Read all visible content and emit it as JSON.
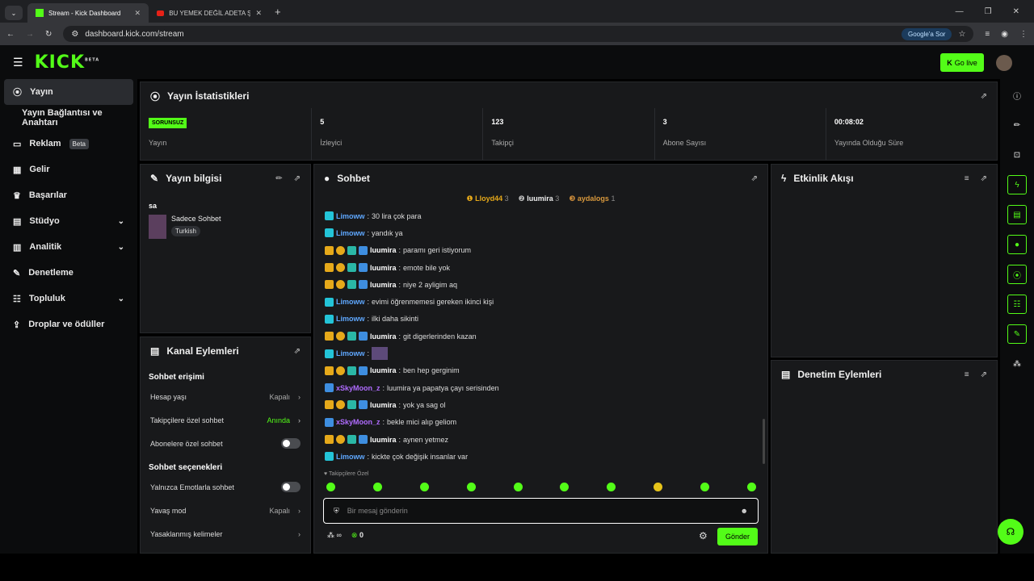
{
  "browser": {
    "tabs": [
      {
        "title": "Stream - Kick Dashboard"
      },
      {
        "title": "BU YEMEK DEĞİL ADETA ŞÖLEN"
      }
    ],
    "url": "dashboard.kick.com/stream",
    "google_button": "Google'a Sor"
  },
  "topbar": {
    "logo": "KICK",
    "logo_sup": "BETA",
    "golive": "Go live"
  },
  "sidebar": {
    "items": [
      {
        "label": "Yayın"
      },
      {
        "label": "Yayın Bağlantısı ve Anahtarı"
      },
      {
        "label": "Reklam",
        "badge": "Beta"
      },
      {
        "label": "Gelir"
      },
      {
        "label": "Başarılar"
      },
      {
        "label": "Stüdyo"
      },
      {
        "label": "Analitik"
      },
      {
        "label": "Denetleme"
      },
      {
        "label": "Topluluk"
      },
      {
        "label": "Droplar ve ödüller"
      }
    ]
  },
  "stats": {
    "title": "Yayın İstatistikleri",
    "items": [
      {
        "value": "SORUNSUZ",
        "label": "Yayın"
      },
      {
        "value": "5",
        "label": "İzleyici"
      },
      {
        "value": "123",
        "label": "Takipçi"
      },
      {
        "value": "3",
        "label": "Abone Sayısı"
      },
      {
        "value": "00:08:02",
        "label": "Yayında Olduğu Süre"
      }
    ]
  },
  "info": {
    "title": "Yayın bilgisi",
    "stream_title": "sa",
    "category": "Sadece Sohbet",
    "language": "Turkish"
  },
  "channel_actions": {
    "title": "Kanal Eylemleri",
    "section1": "Sohbet erişimi",
    "opts1": [
      {
        "label": "Hesap yaşı",
        "value": "Kapalı"
      },
      {
        "label": "Takipçilere özel sohbet",
        "value": "Anında"
      },
      {
        "label": "Abonelere özel sohbet",
        "value": ""
      }
    ],
    "section2": "Sohbet seçenekleri",
    "opts2": [
      {
        "label": "Yalnızca Emotlarla sohbet",
        "value": ""
      },
      {
        "label": "Yavaş mod",
        "value": "Kapalı"
      },
      {
        "label": "Yasaklanmış kelimeler",
        "value": ""
      }
    ]
  },
  "chat": {
    "title": "Sohbet",
    "top": [
      {
        "name": "Lloyd44",
        "count": "3"
      },
      {
        "name": "luumira",
        "count": "3"
      },
      {
        "name": "aydalogs",
        "count": "1"
      }
    ],
    "messages": [
      {
        "user": "Limoww",
        "text": "30 lira çok para"
      },
      {
        "user": "Limoww",
        "text": "yandık ya"
      },
      {
        "user": "luumira",
        "text": "paramı geri istiyorum"
      },
      {
        "user": "luumira",
        "text": "emote bile yok"
      },
      {
        "user": "luumira",
        "text": "niye 2 ayligim aq"
      },
      {
        "user": "Limoww",
        "text": "evimi öğrenmemesi gereken ikinci kişi"
      },
      {
        "user": "Limoww",
        "text": "ilki daha sikinti"
      },
      {
        "user": "luumira",
        "text": "git digerlerinden kazan"
      },
      {
        "user": "Limoww",
        "text": ""
      },
      {
        "user": "luumira",
        "text": "ben hep gerginim"
      },
      {
        "user": "xSkyMoon_z",
        "text": "luumira ya papatya çayı serisinden"
      },
      {
        "user": "luumira",
        "text": "yok ya sag ol"
      },
      {
        "user": "xSkyMoon_z",
        "text": "bekle mici alıp geliom"
      },
      {
        "user": "luumira",
        "text": "aynen yetmez"
      },
      {
        "user": "Limoww",
        "text": "kickte çok değişik insanlar var"
      }
    ],
    "followers_only": "Takipçilere Özel",
    "placeholder": "Bir mesaj gönderin",
    "points": "0",
    "send": "Gönder"
  },
  "activity": {
    "title": "Etkinlik Akışı"
  },
  "mod_actions": {
    "title": "Denetim Eylemleri"
  }
}
